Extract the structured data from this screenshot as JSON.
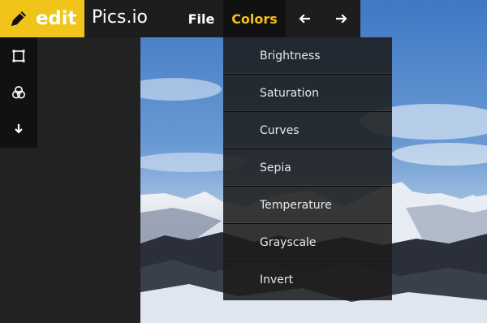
{
  "brand": {
    "label": "edit",
    "icon": "pencil-icon",
    "color": "#f0c419"
  },
  "app_name": "Pics.io",
  "menubar": {
    "file_label": "File",
    "colors_label": "Colors",
    "back_icon": "arrow-left-icon",
    "forward_icon": "arrow-right-icon",
    "active_color": "#f3c11a"
  },
  "left_toolbar": {
    "items": [
      {
        "icon": "crop-icon"
      },
      {
        "icon": "color-circles-icon"
      },
      {
        "icon": "download-arrow-icon"
      }
    ]
  },
  "colors_menu": {
    "items": [
      {
        "label": "Brightness"
      },
      {
        "label": "Saturation"
      },
      {
        "label": "Curves"
      },
      {
        "label": "Sepia"
      },
      {
        "label": "Temperature"
      },
      {
        "label": "Grayscale"
      },
      {
        "label": "Invert"
      }
    ]
  }
}
